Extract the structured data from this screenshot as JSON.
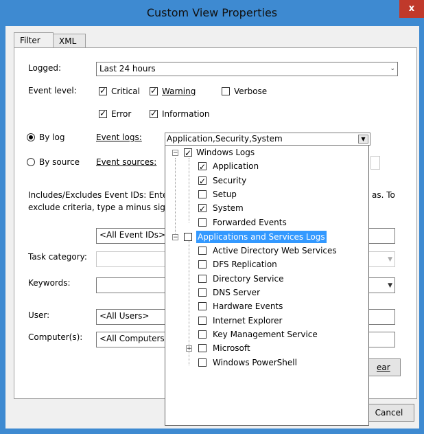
{
  "window": {
    "title": "Custom View Properties",
    "close_glyph": "x"
  },
  "tabs": [
    {
      "label": "Filter",
      "active": true
    },
    {
      "label": "XML",
      "active": false
    }
  ],
  "filter": {
    "logged_label": "Logged:",
    "logged_value": "Last 24 hours",
    "event_level_label": "Event level:",
    "levels": {
      "critical": {
        "label": "Critical",
        "checked": true
      },
      "warning": {
        "label": "Warning",
        "checked": true
      },
      "verbose": {
        "label": "Verbose",
        "checked": false
      },
      "error": {
        "label": "Error",
        "checked": true
      },
      "information": {
        "label": "Information",
        "checked": true
      }
    },
    "by_log_label": "By log",
    "by_source_label": "By source",
    "event_logs_label": "Event logs:",
    "event_logs_value": "Application,Security,System",
    "event_sources_label": "Event sources:",
    "includes_text_1a": "Includes/Excludes Event IDs: Enter",
    "includes_text_1b": "as. To",
    "includes_text_2": "exclude criteria, type a minus sign",
    "event_ids_placeholder": "<All Event IDs>",
    "task_category_label": "Task category:",
    "keywords_label": "Keywords:",
    "user_label": "User:",
    "user_value": "<All Users>",
    "computers_label": "Computer(s):",
    "computers_value": "<All Computers",
    "clear_partial": "ear"
  },
  "buttons": {
    "cancel": "Cancel"
  },
  "tree": {
    "windows_logs": {
      "label": "Windows Logs",
      "checked": true
    },
    "windows_children": [
      {
        "label": "Application",
        "checked": true
      },
      {
        "label": "Security",
        "checked": true
      },
      {
        "label": "Setup",
        "checked": false
      },
      {
        "label": "System",
        "checked": true
      },
      {
        "label": "Forwarded Events",
        "checked": false
      }
    ],
    "apps_services": {
      "label": "Applications and Services Logs",
      "checked": false
    },
    "apps_children": [
      {
        "label": "Active Directory Web Services",
        "checked": false
      },
      {
        "label": "DFS Replication",
        "checked": false
      },
      {
        "label": "Directory Service",
        "checked": false
      },
      {
        "label": "DNS Server",
        "checked": false
      },
      {
        "label": "Hardware Events",
        "checked": false
      },
      {
        "label": "Internet Explorer",
        "checked": false
      },
      {
        "label": "Key Management Service",
        "checked": false
      },
      {
        "label": "Microsoft",
        "checked": false,
        "expandable": true
      },
      {
        "label": "Windows PowerShell",
        "checked": false
      }
    ]
  }
}
